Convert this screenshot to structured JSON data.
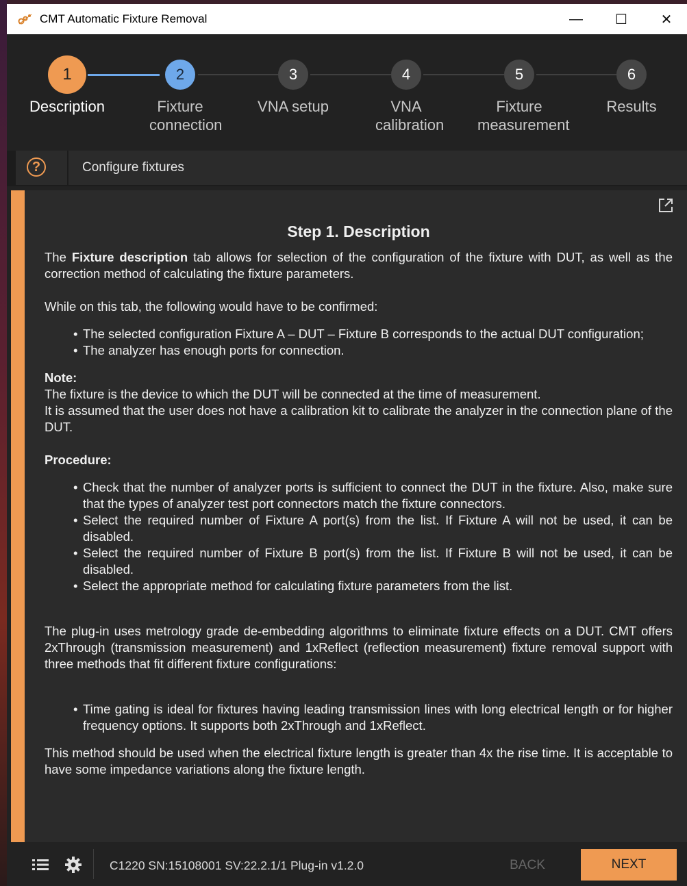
{
  "window": {
    "title": "CMT Automatic Fixture Removal",
    "controls": {
      "minimize": "—",
      "maximize": "☐",
      "close": "✕"
    }
  },
  "steps": [
    {
      "num": "1",
      "label": "Description",
      "state": "active"
    },
    {
      "num": "2",
      "label": "Fixture connection",
      "state": "current"
    },
    {
      "num": "3",
      "label": "VNA setup",
      "state": "pending"
    },
    {
      "num": "4",
      "label": "VNA calibration",
      "state": "pending"
    },
    {
      "num": "5",
      "label": "Fixture measurement",
      "state": "pending"
    },
    {
      "num": "6",
      "label": "Results",
      "state": "pending"
    }
  ],
  "hint": {
    "help_symbol": "?",
    "text": "Configure fixtures"
  },
  "doc": {
    "heading": "Step 1. Description",
    "intro_bold": "Fixture description",
    "intro_pre": "The ",
    "intro_post": " tab allows for selection of the configuration of the fixture with DUT, as well as the correction method of calculating the fixture parameters.",
    "confirm_lead": "While on this tab, the following would have to be confirmed:",
    "confirm_items": [
      "The selected configuration Fixture A – DUT – Fixture B corresponds to the actual DUT configuration;",
      "The analyzer has enough ports for connection."
    ],
    "note_title": "Note:",
    "note_line1": "The fixture is the device to which the DUT will be connected at the time of measurement.",
    "note_line2": "It is assumed that the user does not have a calibration kit to calibrate the analyzer in the connection plane of the DUT.",
    "procedure_title": "Procedure:",
    "procedure_items": [
      "Check that the number of analyzer ports is sufficient to connect the DUT in the fixture. Also, make sure that the types of analyzer test port connectors match the fixture connectors.",
      "Select the required number of Fixture A port(s) from the list. If Fixture A will not be used, it can be disabled.",
      "Select the required number of Fixture B port(s) from the list. If Fixture B will not be used, it can be disabled.",
      "Select the appropriate method for calculating fixture parameters from the list."
    ],
    "plugin_para": "The plug-in uses metrology grade de-embedding algorithms to eliminate fixture effects on a DUT. CMT offers 2xThrough (transmission measurement) and 1xReflect (reflection measurement) fixture removal support with three methods that fit different fixture configurations:",
    "gating_items": [
      "Time gating is ideal for fixtures having leading transmission lines with long electrical length or for higher frequency options. It supports both 2xThrough and 1xReflect."
    ],
    "method_para": "This method should be used when the electrical fixture length is greater than 4x the rise time. It is acceptable to have some impedance variations along the fixture length."
  },
  "footer": {
    "device_info": "C1220 SN:15108001 SV:22.2.1/1 Plug-in v1.2.0",
    "back_label": "BACK",
    "next_label": "NEXT"
  },
  "colors": {
    "accent": "#ef9a52",
    "current_step": "#6ea8ea",
    "background": "#222222",
    "panel": "#2b2b2b"
  }
}
